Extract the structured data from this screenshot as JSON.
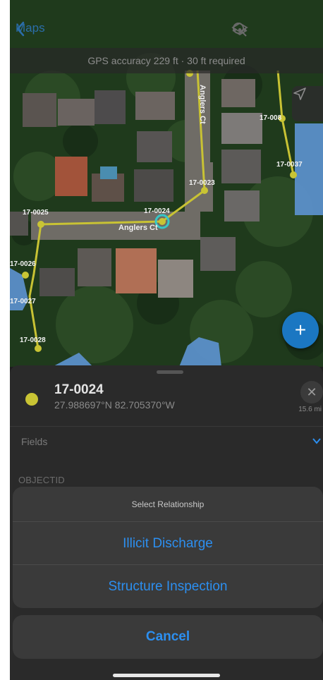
{
  "nav": {
    "back_label": "Maps",
    "icons": [
      "layers-icon",
      "search-icon",
      "more-icon"
    ]
  },
  "gps_banner": "GPS accuracy 229 ft  ·  30 ft required",
  "map": {
    "streets": [
      "Anglers Ct",
      "Anglers Ct"
    ],
    "point_labels": [
      "17-0024",
      "17-0025",
      "17-0026",
      "17-0027",
      "17-0028",
      "17-0023",
      "17-0037",
      "17-008"
    ],
    "selected_point": "17-0024"
  },
  "feature": {
    "title": "17-0024",
    "coordinates": "27.988697°N  82.705370°W",
    "distance": "15.6 mi",
    "fields_label": "Fields",
    "first_field": "OBJECTID"
  },
  "action_sheet": {
    "title": "Select Relationship",
    "options": [
      "Illicit Discharge",
      "Structure Inspection"
    ],
    "cancel": "Cancel"
  },
  "colors": {
    "accent": "#2c8ff0",
    "point": "#c9c434",
    "line": "#c8c234",
    "polygon": "#5b8fc9"
  }
}
